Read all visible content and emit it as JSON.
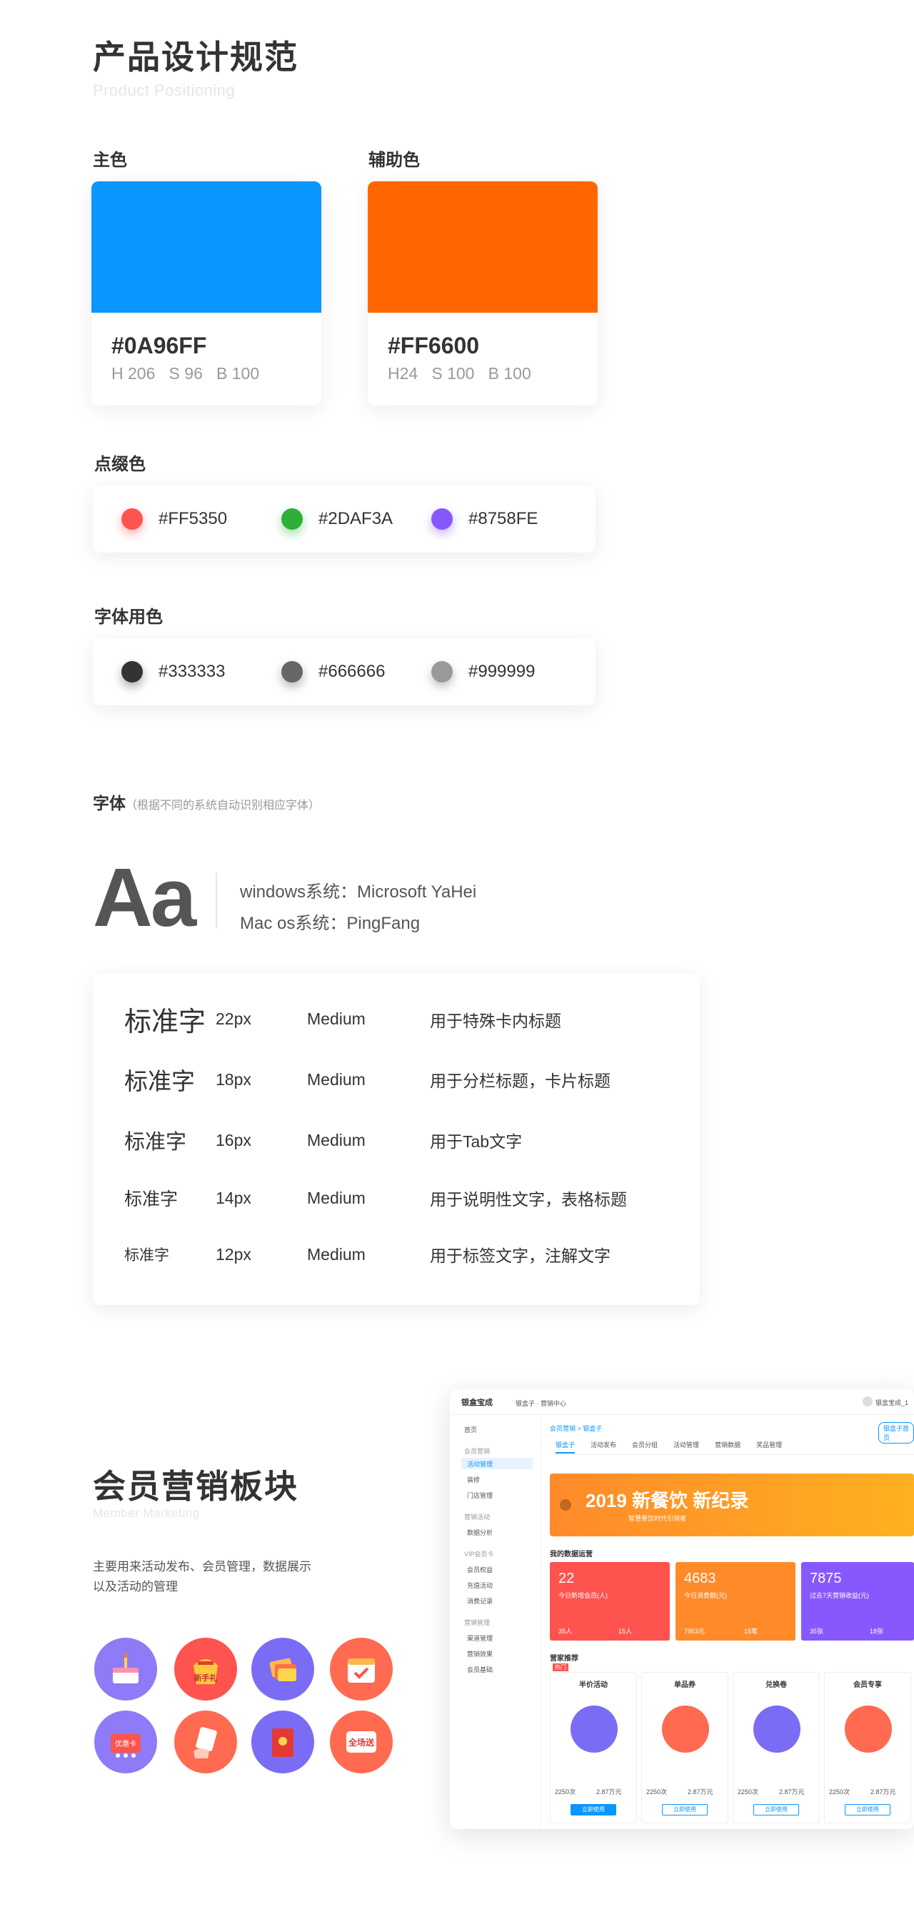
{
  "header": {
    "title": "产品设计规范",
    "subtitle": "Product Positioning"
  },
  "primary": {
    "label": "主色",
    "hex": "#0A96FF",
    "hsb": "H 206   S 96   B 100",
    "color": "#0A96FF"
  },
  "secondary": {
    "label": "辅助色",
    "hex": "#FF6600",
    "hsb": "H24   S 100   B 100",
    "color": "#FF6600"
  },
  "accent": {
    "label": "点缀色",
    "items": [
      {
        "hex": "#FF5350",
        "color": "#FF5350"
      },
      {
        "hex": "#2DAF3A",
        "color": "#2DAF3A"
      },
      {
        "hex": "#8758FE",
        "color": "#8758FE"
      }
    ]
  },
  "textcolor": {
    "label": "字体用色",
    "items": [
      {
        "hex": "#333333",
        "color": "#333333"
      },
      {
        "hex": "#666666",
        "color": "#666666"
      },
      {
        "hex": "#999999",
        "color": "#999999"
      }
    ]
  },
  "font": {
    "label": "字体",
    "note": "（根据不同的系统自动识别相应字体）",
    "sample": "Aa",
    "windows": "windows系统：Microsoft YaHei",
    "mac": "Mac os系统：PingFang"
  },
  "type_scale": [
    {
      "sample": "标准字",
      "size": "22px",
      "weight": "Medium",
      "usage": "用于特殊卡内标题"
    },
    {
      "sample": "标准字",
      "size": "18px",
      "weight": "Medium",
      "usage": "用于分栏标题，卡片标题"
    },
    {
      "sample": "标准字",
      "size": "16px",
      "weight": "Medium",
      "usage": "用于Tab文字"
    },
    {
      "sample": "标准字",
      "size": "14px",
      "weight": "Medium",
      "usage": "用于说明性文字，表格标题"
    },
    {
      "sample": "标准字",
      "size": "12px",
      "weight": "Medium",
      "usage": "用于标签文字，注解文字"
    }
  ],
  "member": {
    "title": "会员营销板块",
    "subtitle": "Member Marketing",
    "desc1": "主要用来活动发布、会员管理，数据展示",
    "desc2": "以及活动的管理"
  },
  "dashboard": {
    "logo": "银盒宝成",
    "breadcrumb_top": "银盒子 · 营销中心",
    "user": "银盒宝成_1",
    "crumb": "会员营销 > 银盒子",
    "top_btn": "银盒子首页",
    "sidebar": [
      "首页",
      "会员营销",
      "活动管理",
      "装修",
      "门店管理",
      "营销活动",
      "数据分析",
      "VIP会员卡",
      "会员权益",
      "充值活动",
      "消费记录",
      "营销管理",
      "渠道管理",
      "营销效果",
      "会员基础"
    ],
    "tabs": [
      "银盒子",
      "活动发布",
      "会员分组",
      "活动管理",
      "营销数据",
      "奖品管理"
    ],
    "banner_text": "2019 新餐饮 新纪录",
    "banner_sub": "智慧餐饮时代引领者",
    "ops_title": "我的数据运营",
    "stats": [
      {
        "value": "22",
        "label": "今日新增会员(人)",
        "a": "35人",
        "b": "15人",
        "color": "#FF5350"
      },
      {
        "value": "4683",
        "label": "今日消费额(元)",
        "a": "7953元",
        "b": "15笔",
        "color": "#FF8A2A"
      },
      {
        "value": "7875",
        "label": "过去7天营销收益(元)",
        "a": "35张",
        "b": "18张",
        "color": "#8758FE"
      }
    ],
    "rec_title": "营家推荐",
    "rec_badge": "热门",
    "recs": [
      {
        "name": "半价活动",
        "btn": "立即使用"
      },
      {
        "name": "单品券",
        "btn": "立即使用"
      },
      {
        "name": "兑换卷",
        "btn": "立即使用"
      },
      {
        "name": "会员专享",
        "btn": "立即使用"
      }
    ],
    "rec_stat_a": "2250次",
    "rec_stat_b": "2.87万元"
  },
  "icons": [
    "cake-icon",
    "new-user-gift-icon",
    "cards-icon",
    "calendar-icon",
    "coupon-icon",
    "hand-card-icon",
    "red-envelope-icon",
    "full-reduction-icon"
  ],
  "icon_texts": {
    "gift": "新手礼",
    "card": "优惠卡",
    "full": "全场送"
  }
}
